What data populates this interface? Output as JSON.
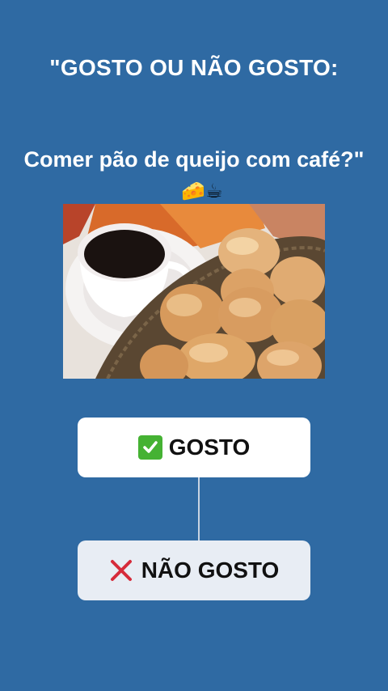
{
  "header": {
    "title": "\"GOSTO OU NÃO GOSTO:",
    "question": "Comer pão de queijo com café?\"",
    "emojis": "🧀☕"
  },
  "photo": {
    "icon": "coffee-and-cheese-bread-photo"
  },
  "options": {
    "like_label": "GOSTO",
    "like_icon": "check-mark-icon",
    "dislike_label": "NÃO GOSTO",
    "dislike_icon": "cross-mark-icon"
  },
  "colors": {
    "background": "#2f6aa3",
    "check_green": "#45b233",
    "cross_red": "#d62b3a"
  }
}
